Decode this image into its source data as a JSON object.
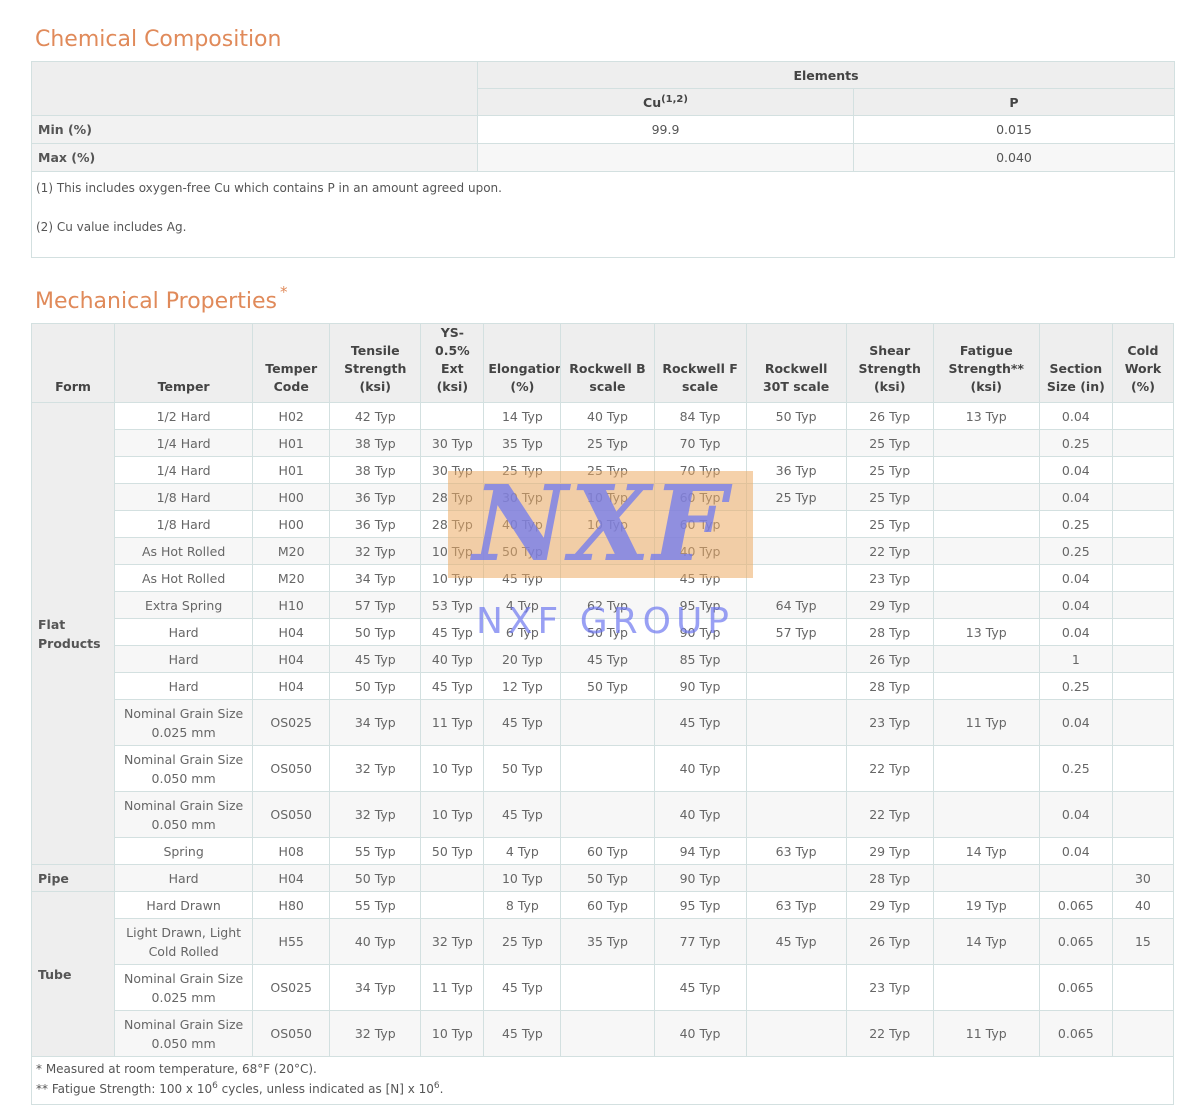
{
  "chemical": {
    "title": "Chemical Composition",
    "elements_label": "Elements",
    "cols": [
      {
        "name": "Cu",
        "sup": "(1,2)"
      },
      {
        "name": "P",
        "sup": ""
      }
    ],
    "rows": [
      {
        "label": "Min (%)",
        "values": [
          "99.9",
          "0.015"
        ]
      },
      {
        "label": "Max (%)",
        "values": [
          "",
          "0.040"
        ]
      }
    ],
    "notes": [
      "(1) This includes oxygen-free Cu which contains P in an amount agreed upon.",
      "(2) Cu value includes Ag."
    ]
  },
  "mechanical": {
    "title": "Mechanical Properties",
    "title_mark": "*",
    "headers": [
      "Form",
      "Temper",
      "Temper Code",
      "Tensile Strength (ksi)",
      "YS-0.5% Ext (ksi)",
      "Elongation (%)",
      "Rockwell B scale",
      "Rockwell F scale",
      "Rockwell 30T scale",
      "Shear Strength (ksi)",
      "Fatigue Strength** (ksi)",
      "Section Size (in)",
      "Cold Work (%)"
    ],
    "groups": [
      {
        "form": "Flat Products",
        "rows": [
          [
            "1/2 Hard",
            "H02",
            "42 Typ",
            "",
            "14 Typ",
            "40 Typ",
            "84 Typ",
            "50 Typ",
            "26 Typ",
            "13 Typ",
            "0.04",
            ""
          ],
          [
            "1/4 Hard",
            "H01",
            "38 Typ",
            "30 Typ",
            "35 Typ",
            "25 Typ",
            "70 Typ",
            "",
            "25 Typ",
            "",
            "0.25",
            ""
          ],
          [
            "1/4 Hard",
            "H01",
            "38 Typ",
            "30 Typ",
            "25 Typ",
            "25 Typ",
            "70 Typ",
            "36 Typ",
            "25 Typ",
            "",
            "0.04",
            ""
          ],
          [
            "1/8 Hard",
            "H00",
            "36 Typ",
            "28 Typ",
            "30 Typ",
            "10 Typ",
            "60 Typ",
            "25 Typ",
            "25 Typ",
            "",
            "0.04",
            ""
          ],
          [
            "1/8 Hard",
            "H00",
            "36 Typ",
            "28 Typ",
            "40 Typ",
            "10 Typ",
            "60 Typ",
            "",
            "25 Typ",
            "",
            "0.25",
            ""
          ],
          [
            "As Hot Rolled",
            "M20",
            "32 Typ",
            "10 Typ",
            "50 Typ",
            "",
            "40 Typ",
            "",
            "22 Typ",
            "",
            "0.25",
            ""
          ],
          [
            "As Hot Rolled",
            "M20",
            "34 Typ",
            "10 Typ",
            "45 Typ",
            "",
            "45 Typ",
            "",
            "23 Typ",
            "",
            "0.04",
            ""
          ],
          [
            "Extra Spring",
            "H10",
            "57 Typ",
            "53 Typ",
            "4 Typ",
            "62 Typ",
            "95 Typ",
            "64 Typ",
            "29 Typ",
            "",
            "0.04",
            ""
          ],
          [
            "Hard",
            "H04",
            "50 Typ",
            "45 Typ",
            "6 Typ",
            "50 Typ",
            "90 Typ",
            "57 Typ",
            "28 Typ",
            "13 Typ",
            "0.04",
            ""
          ],
          [
            "Hard",
            "H04",
            "45 Typ",
            "40 Typ",
            "20 Typ",
            "45 Typ",
            "85 Typ",
            "",
            "26 Typ",
            "",
            "1",
            ""
          ],
          [
            "Hard",
            "H04",
            "50 Typ",
            "45 Typ",
            "12 Typ",
            "50 Typ",
            "90 Typ",
            "",
            "28 Typ",
            "",
            "0.25",
            ""
          ],
          [
            "Nominal Grain Size 0.025 mm",
            "OS025",
            "34 Typ",
            "11 Typ",
            "45 Typ",
            "",
            "45 Typ",
            "",
            "23 Typ",
            "11 Typ",
            "0.04",
            ""
          ],
          [
            "Nominal Grain Size 0.050 mm",
            "OS050",
            "32 Typ",
            "10 Typ",
            "50 Typ",
            "",
            "40 Typ",
            "",
            "22 Typ",
            "",
            "0.25",
            ""
          ],
          [
            "Nominal Grain Size 0.050 mm",
            "OS050",
            "32 Typ",
            "10 Typ",
            "45 Typ",
            "",
            "40 Typ",
            "",
            "22 Typ",
            "",
            "0.04",
            ""
          ],
          [
            "Spring",
            "H08",
            "55 Typ",
            "50 Typ",
            "4 Typ",
            "60 Typ",
            "94 Typ",
            "63 Typ",
            "29 Typ",
            "14 Typ",
            "0.04",
            ""
          ]
        ]
      },
      {
        "form": "Pipe",
        "rows": [
          [
            "Hard",
            "H04",
            "50 Typ",
            "",
            "10 Typ",
            "50 Typ",
            "90 Typ",
            "",
            "28 Typ",
            "",
            "",
            "30"
          ]
        ]
      },
      {
        "form": "Tube",
        "rows": [
          [
            "Hard Drawn",
            "H80",
            "55 Typ",
            "",
            "8 Typ",
            "60 Typ",
            "95 Typ",
            "63 Typ",
            "29 Typ",
            "19 Typ",
            "0.065",
            "40"
          ],
          [
            "Light Drawn, Light Cold Rolled",
            "H55",
            "40 Typ",
            "32 Typ",
            "25 Typ",
            "35 Typ",
            "77 Typ",
            "45 Typ",
            "26 Typ",
            "14 Typ",
            "0.065",
            "15"
          ],
          [
            "Nominal Grain Size 0.025 mm",
            "OS025",
            "34 Typ",
            "11 Typ",
            "45 Typ",
            "",
            "45 Typ",
            "",
            "23 Typ",
            "",
            "0.065",
            ""
          ],
          [
            "Nominal Grain Size 0.050 mm",
            "OS050",
            "32 Typ",
            "10 Typ",
            "45 Typ",
            "",
            "40 Typ",
            "",
            "22 Typ",
            "11 Typ",
            "0.065",
            ""
          ]
        ]
      }
    ],
    "footnote1": "* Measured at room temperature, 68°F (20°C).",
    "footnote2_a": "** Fatigue Strength: 100 x 10",
    "footnote2_sup1": "6",
    "footnote2_b": " cycles, unless indicated as [N] x 10",
    "footnote2_sup2": "6",
    "footnote2_c": "."
  },
  "watermark": {
    "logo_text": "NXF",
    "group_text": "NXF GROUP"
  }
}
